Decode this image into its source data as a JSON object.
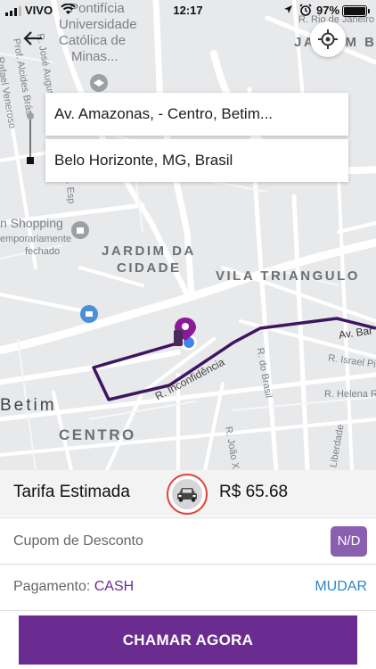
{
  "status_bar": {
    "carrier": "VIVO",
    "time": "12:17",
    "battery": "97%",
    "icons": [
      "signal-bars-icon",
      "wifi-icon",
      "location-arrow-icon",
      "alarm-icon",
      "battery-icon"
    ]
  },
  "map": {
    "labels": {
      "pontificia": "Pontifícia",
      "universidade": "Universidade",
      "catolica": "Católica de",
      "minas": "Minas...",
      "jardim_b": "JARDIM B",
      "rua_rio": "R. Rio de Janeiro",
      "jardim_da": "JARDIM DA",
      "cidade": "CIDADE",
      "vila_triangulo": "VILA TRIANGULO",
      "betim": "Betim",
      "centro": "CENTRO",
      "shopping": "n Shopping",
      "temporariamente": "emporariamente",
      "fechado": "fechado",
      "av_bar": "Av. Bar",
      "israel": "R. Israel Pinh",
      "helena": "R. Helena Roc",
      "inconfidencia": "R. Inconfidência",
      "do_brasil": "R. do Brasil",
      "joao": "R. João X",
      "liberdade": "Liberdade",
      "alcides": "Prof. Alcides Brás",
      "veneroso": "Rafael Veneroso",
      "jose_august": "R. José August",
      "esp": "R. Esp"
    },
    "route_color": "#3e1560",
    "accent_color": "#8b1a9a"
  },
  "origin": {
    "address": "Av. Amazonas,          - Centro, Betim..."
  },
  "destination": {
    "address": "Belo Horizonte, MG, Brasil"
  },
  "fare": {
    "label": "Tarifa Estimada",
    "value": "R$ 65.68",
    "vehicle_icon": "car-icon"
  },
  "coupon": {
    "label": "Cupom de Desconto",
    "badge": "N/D"
  },
  "payment": {
    "label": "Pagamento:",
    "method": "CASH",
    "change_label": "MUDAR"
  },
  "cta": {
    "label": "CHAMAR AGORA",
    "color": "#6b2c91"
  }
}
